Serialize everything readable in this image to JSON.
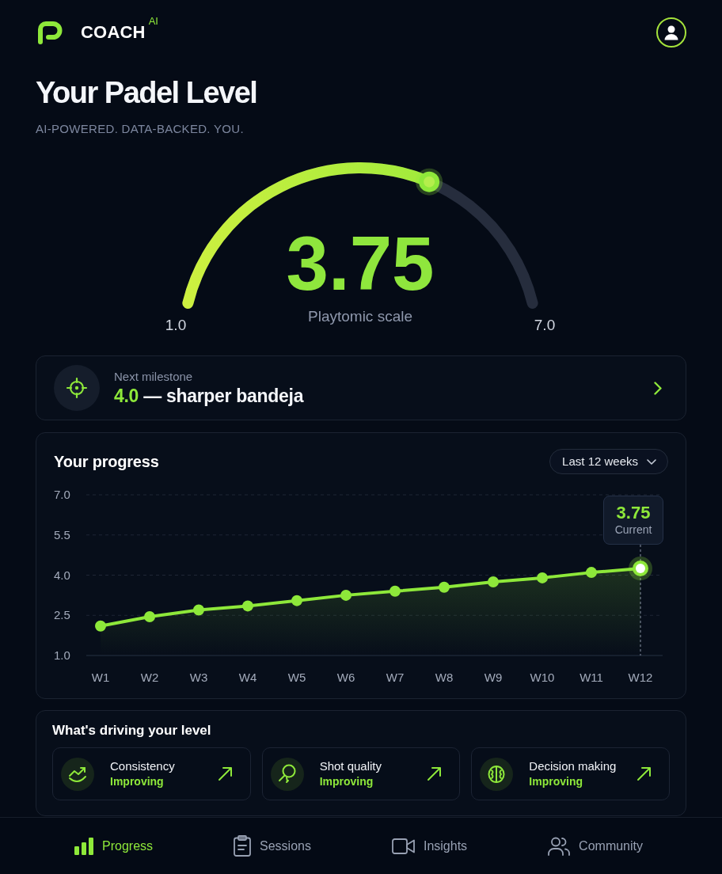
{
  "header": {
    "brand": "COACH",
    "badge": "AI"
  },
  "title": "Your Padel Level",
  "subtitle": "AI-POWERED. DATA-BACKED. YOU.",
  "gauge": {
    "value": "3.75",
    "caption": "Playtomic scale",
    "min_label": "1.0",
    "max_label": "7.0",
    "level": 0.65
  },
  "milestone": {
    "label": "Next milestone",
    "target": "4.0",
    "title": "— sharper bandeja"
  },
  "progress": {
    "title": "Your progress",
    "range": "Last 12 weeks",
    "chart_data": {
      "type": "line",
      "categories": [
        "W1",
        "W2",
        "W3",
        "W4",
        "W5",
        "W6",
        "W7",
        "W8",
        "W9",
        "W10",
        "W11",
        "W12"
      ],
      "series": [
        {
          "color": "#8ee83a",
          "marker": "circle",
          "values": [
            2.1,
            2.45,
            2.7,
            2.85,
            3.05,
            3.25,
            3.4,
            3.55,
            3.75,
            3.9,
            4.1,
            4.25
          ]
        }
      ],
      "ylim": [
        1,
        7
      ],
      "yticks": [
        {
          "value": 1,
          "label": "1.0"
        },
        {
          "value": 2.5,
          "label": "2.5"
        },
        {
          "value": 4,
          "label": "4.0"
        },
        {
          "value": 5.5,
          "label": "5.5"
        },
        {
          "value": 7,
          "label": "7.0"
        }
      ],
      "grid": true,
      "annotations": [
        "3.75",
        "Current"
      ]
    }
  },
  "drivers": {
    "title": "What's driving your level",
    "items": [
      {
        "kind": "trend",
        "name": "Consistency",
        "status": "Improving"
      },
      {
        "kind": "racket",
        "name": "Shot quality",
        "status": "Improving"
      },
      {
        "kind": "brain",
        "name": "Decision making",
        "status": "Improving"
      }
    ]
  },
  "nav": [
    {
      "kind": "bars",
      "label": "Progress",
      "selected": true
    },
    {
      "kind": "clipboard",
      "label": "Sessions",
      "selected": false
    },
    {
      "kind": "camera",
      "label": "Insights",
      "selected": false
    },
    {
      "kind": "people",
      "label": "Community",
      "selected": false
    }
  ]
}
